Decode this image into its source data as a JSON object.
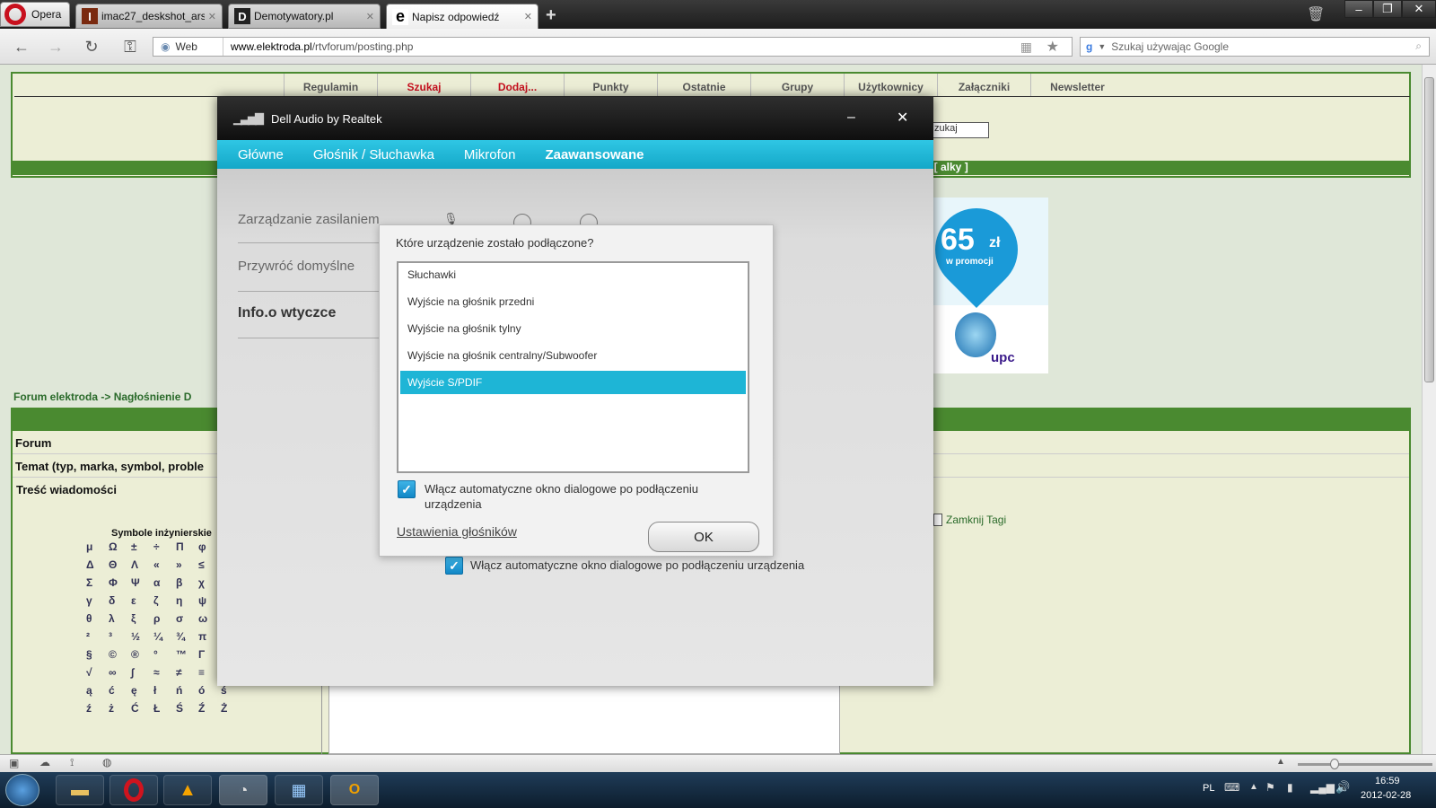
{
  "browser": {
    "menu_label": "Opera",
    "tabs": [
      {
        "label": "imac27_deskshot_ars.J...",
        "fav": "I"
      },
      {
        "label": "Demotywatory.pl",
        "fav": "D"
      },
      {
        "label": "Napisz odpowiedź",
        "fav": "e"
      }
    ],
    "site_label": "Web",
    "url_domain": "www.elektroda.pl",
    "url_path": "/rtvforum/posting.php",
    "search_placeholder": "Szukaj używając Google"
  },
  "forum": {
    "nav": [
      "Regulamin",
      "Szukaj",
      "Dodaj...",
      "Punkty",
      "Ostatnie",
      "Grupy",
      "Użytkownicy",
      "Załączniki",
      "Newsletter"
    ],
    "search_field_value": "zukaj",
    "greenbar_text": "j [ alky ]",
    "breadcrumb": "Forum elektroda -> Nagłośnienie D",
    "row_forum": "Forum",
    "row_topic": "Temat (typ, marka, symbol, proble",
    "row_body": "Treść wiadomości",
    "symbols_title": "Symbole inżynierskie",
    "symbols": [
      "μ",
      "Ω",
      "±",
      "÷",
      "Π",
      "φ",
      "",
      "Δ",
      "Θ",
      "Λ",
      "«",
      "»",
      "≤",
      "",
      "Σ",
      "Φ",
      "Ψ",
      "α",
      "β",
      "χ",
      "",
      "γ",
      "δ",
      "ε",
      "ζ",
      "η",
      "ψ",
      "",
      "θ",
      "λ",
      "ξ",
      "ρ",
      "σ",
      "ω",
      "",
      "²",
      "³",
      "½",
      "¼",
      "¾",
      "π",
      "",
      "§",
      "©",
      "®",
      "°",
      "™",
      "Γ",
      "",
      "√",
      "∞",
      "∫",
      "≈",
      "≠",
      "≡",
      "≡",
      "ą",
      "ć",
      "ę",
      "ł",
      "ń",
      "ó",
      "ś",
      "ź",
      "ż",
      "Ć",
      "Ł",
      "Ś",
      "Ź",
      "Ż"
    ],
    "close_tags": "Zamknij Tagi",
    "ad_price": "65",
    "ad_unit": "zł",
    "ad_promo": "w promocji",
    "ad_brand": "upc"
  },
  "dell": {
    "title": "Dell Audio by Realtek",
    "tabs": [
      "Główne",
      "Głośnik / Słuchawka",
      "Mikrofon",
      "Zaawansowane"
    ],
    "selected_tab": "Zaawansowane",
    "side": [
      "Zarządzanie zasilaniem",
      "Przywróć domyślne",
      "Info.o wtyczce"
    ],
    "bottom_checkbox": "Włącz automatyczne okno dialogowe po podłączeniu urządzenia"
  },
  "dialog": {
    "question": "Które urządzenie zostało podłączone?",
    "items": [
      "Słuchawki",
      "Wyjście na głośnik przedni",
      "Wyjście na głośnik tylny",
      "Wyjście na głośnik centralny/Subwoofer",
      "Wyjście S/PDIF"
    ],
    "selected": "Wyjście S/PDIF",
    "checkbox_line1": "Włącz automatyczne okno dialogowe po podłączeniu",
    "checkbox_line2": "urządzenia",
    "link": "Ustawienia głośników",
    "ok": "OK"
  },
  "taskbar": {
    "lang": "PL",
    "time": "16:59",
    "date": "2012-02-28"
  },
  "colors": {
    "accent_cyan": "#1eb5d6",
    "forum_green": "#4a8a30",
    "opera_red": "#c8101e"
  }
}
